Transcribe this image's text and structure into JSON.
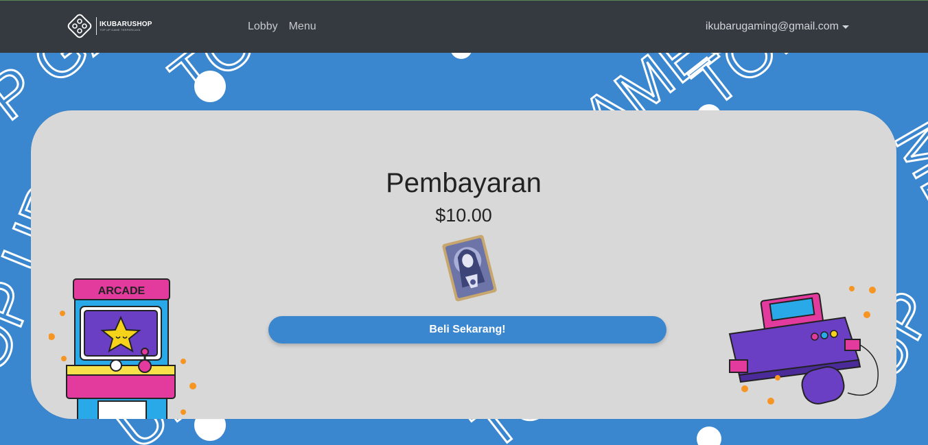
{
  "navbar": {
    "brand_name": "IKUBARUSHOP",
    "brand_tagline": "TOP UP GAME TERPERCAYA",
    "links": [
      {
        "label": "Lobby"
      },
      {
        "label": "Menu"
      }
    ],
    "user_email": "ikubarugaming@gmail.com"
  },
  "background": {
    "pattern_words": [
      "TOP",
      "UP",
      "GAMES"
    ]
  },
  "payment": {
    "title": "Pembayaran",
    "price": "$10.00",
    "button_label": "Beli Sekarang!"
  },
  "decor": {
    "arcade_label": "ARCADE"
  },
  "colors": {
    "navbar_bg": "#343a40",
    "page_bg": "#3a87cf",
    "card_bg": "#d8d8d8",
    "accent": "#3a87cf"
  }
}
